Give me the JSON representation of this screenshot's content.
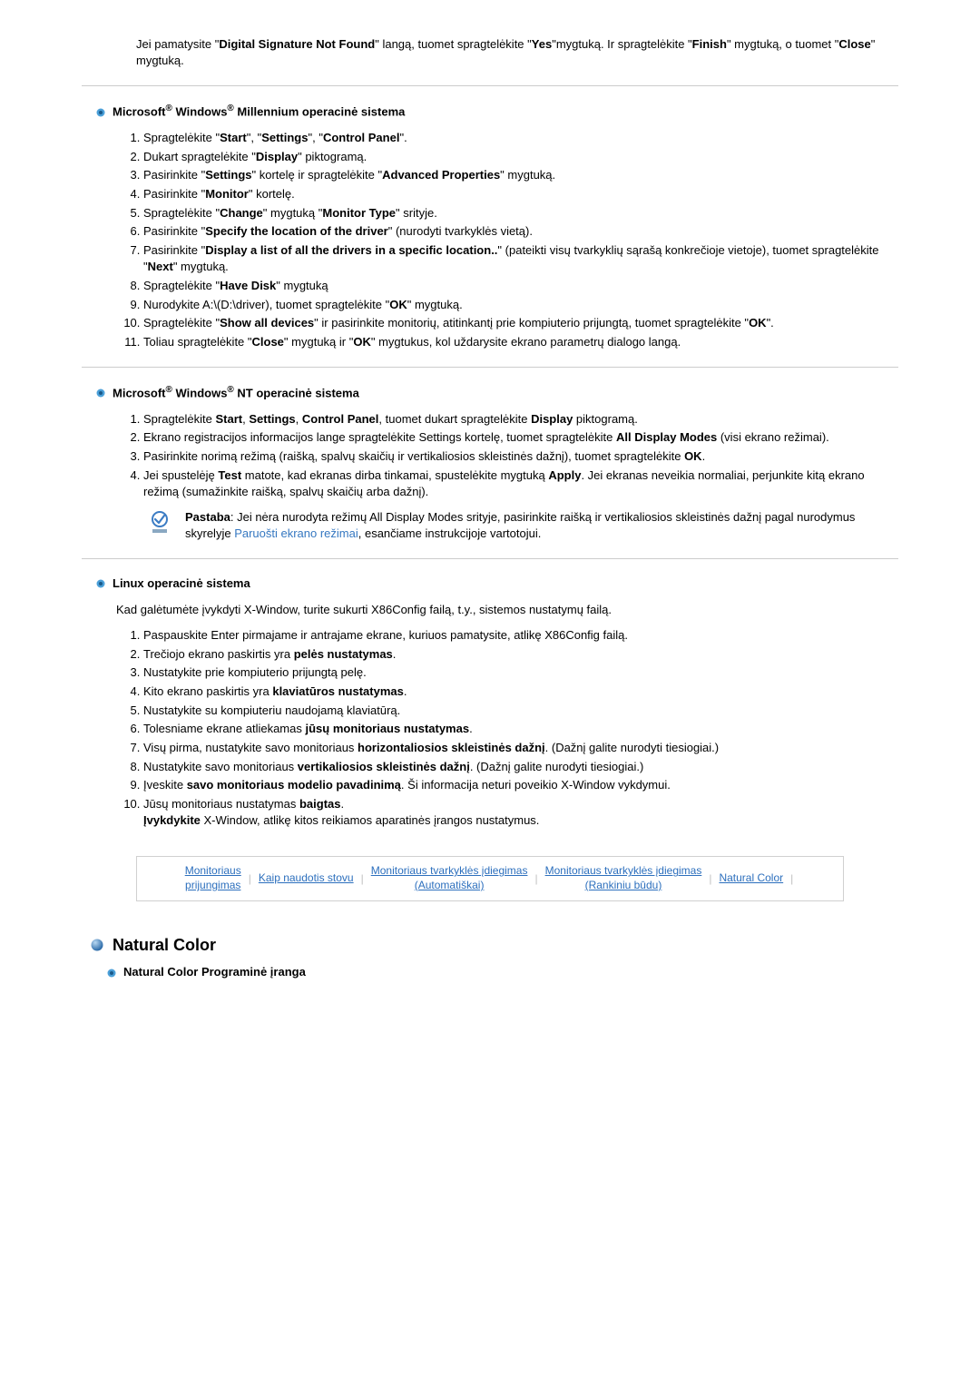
{
  "intro_text": "Jei pamatysite \"Digital Signature Not Found\" langą, tuomet spragtelėkite \"Yes\"mygtuką. Ir spragtelėkite \"Finish\" mygtuką, o tuomet \"Close\" mygtuką.",
  "sections": {
    "me": {
      "title_prefix": "Microsoft",
      "title_mid": " Windows",
      "title_suffix": " Millennium operacinė sistema",
      "steps": [
        "Spragtelėkite \"Start\", \"Settings\", \"Control Panel\".",
        "Dukart spragtelėkite \"Display\" piktogramą.",
        "Pasirinkite \"Settings\" kortelę ir spragtelėkite \"Advanced Properties\" mygtuką.",
        "Pasirinkite \"Monitor\" kortelę.",
        "Spragtelėkite \"Change\" mygtuką \"Monitor Type\" srityje.",
        "Pasirinkite \"Specify the location of the driver\" (nurodyti tvarkyklės vietą).",
        "Pasirinkite \"Display a list of all the drivers in a specific location..\" (pateikti visų tvarkyklių sąrašą konkrečioje vietoje), tuomet spragtelėkite \"Next\" mygtuką.",
        "Spragtelėkite \"Have Disk\" mygtuką",
        "Nurodykite A:\\(D:\\driver), tuomet spragtelėkite \"OK\" mygtuką.",
        "Spragtelėkite \"Show all devices\" ir pasirinkite monitorių, atitinkantį prie kompiuterio prijungtą, tuomet spragtelėkite \"OK\".",
        "Toliau spragtelėkite \"Close\" mygtuką ir \"OK\" mygtukus, kol uždarysite ekrano parametrų dialogo langą."
      ]
    },
    "nt": {
      "title_prefix": "Microsoft",
      "title_mid": " Windows",
      "title_suffix": " NT operacinė sistema",
      "steps": [
        "Spragtelėkite Start, Settings, Control Panel, tuomet dukart spragtelėkite Display piktogramą.",
        "Ekrano registracijos informacijos lange spragtelėkite Settings kortelę, tuomet spragtelėkite All Display Modes (visi ekrano režimai).",
        "Pasirinkite norimą režimą (raišką, spalvų skaičių ir vertikaliosios skleistinės dažnį), tuomet spragtelėkite OK.",
        "Jei spustelėję Test matote, kad ekranas dirba tinkamai, spustelėkite mygtuką Apply. Jei ekranas neveikia normaliai, perjunkite kitą ekrano režimą (sumažinkite raišką, spalvų skaičių arba dažnį)."
      ],
      "note_label": "Pastaba",
      "note_text_before": ": Jei nėra nurodyta režimų All Display Modes srityje, pasirinkite raišką ir vertikaliosios skleistinės dažnį pagal nurodymus skyrelyje ",
      "note_link": "Paruošti ekrano režimai",
      "note_text_after": ", esančiame instrukcijoje vartotojui."
    },
    "linux": {
      "title": "Linux operacinė sistema",
      "intro": "Kad galėtumėte įvykdyti X-Window, turite sukurti X86Config failą, t.y., sistemos nustatymų failą.",
      "steps": [
        "Paspauskite Enter pirmajame ir antrajame ekrane, kuriuos pamatysite, atlikę X86Config failą.",
        "Trečiojo ekrano paskirtis yra pelės nustatymas.",
        "Nustatykite prie kompiuterio prijungtą pelę.",
        "Kito ekrano paskirtis yra klaviatūros nustatymas.",
        "Nustatykite su kompiuteriu naudojamą klaviatūrą.",
        "Tolesniame ekrane atliekamas jūsų monitoriaus nustatymas.",
        "Visų pirma, nustatykite savo monitoriaus horizontaliosios skleistinės dažnį. (Dažnį galite nurodyti tiesiogiai.)",
        "Nustatykite savo monitoriaus vertikaliosios skleistinės dažnį. (Dažnį galite nurodyti tiesiogiai.)",
        "Įveskite savo monitoriaus modelio pavadinimą. Ši informacija neturi poveikio X-Window vykdymui.",
        "Jūsų monitoriaus nustatymas baigtas.\nĮvykdykite X-Window, atlikę kitos reikiamos aparatinės įrangos nustatymus."
      ]
    }
  },
  "nav": {
    "item1_line1": "Monitoriaus",
    "item1_line2": "prijungimas",
    "item2": "Kaip naudotis stovu",
    "item3_line1": "Monitoriaus tvarkyklės įdiegimas",
    "item3_line2": "(Automatiškai)",
    "item4_line1": "Monitoriaus tvarkyklės įdiegimas",
    "item4_line2": "(Rankiniu būdu)",
    "item5": "Natural Color"
  },
  "nc": {
    "title": "Natural Color",
    "sub": "Natural Color Programinė įranga"
  }
}
